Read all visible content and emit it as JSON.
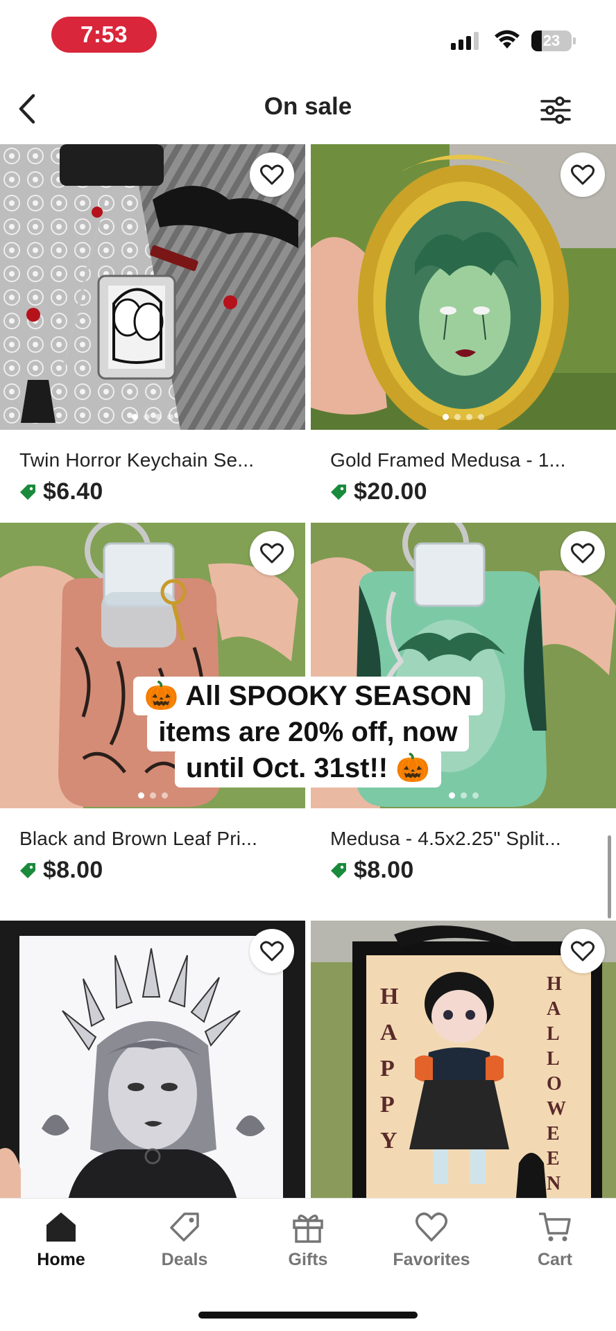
{
  "status_bar": {
    "time": "7:53",
    "battery": "23"
  },
  "header": {
    "title": "On sale"
  },
  "products": [
    {
      "title": "Twin Horror Keychain Se...",
      "price": "$6.40"
    },
    {
      "title": "Gold Framed Medusa - 1...",
      "price": "$20.00"
    },
    {
      "title": "Black and Brown Leaf Pri...",
      "price": "$8.00"
    },
    {
      "title": "Medusa - 4.5x2.25\" Split...",
      "price": "$8.00"
    }
  ],
  "overlay": {
    "lines": [
      "🎃 All SPOOKY SEASON",
      "items are 20% off, now",
      "until Oct. 31st!! 🎃"
    ]
  },
  "card6_art": {
    "left": "HAPPY",
    "right": "HALLOWEEN"
  },
  "nav": [
    {
      "label": "Home",
      "icon": "home-icon",
      "active": true
    },
    {
      "label": "Deals",
      "icon": "tag-icon",
      "active": false
    },
    {
      "label": "Gifts",
      "icon": "gift-icon",
      "active": false
    },
    {
      "label": "Favorites",
      "icon": "heart-icon",
      "active": false
    },
    {
      "label": "Cart",
      "icon": "cart-icon",
      "active": false
    }
  ],
  "colors": {
    "sale_green": "#1a8a3c",
    "time_pill": "#d9263a",
    "text": "#222222"
  }
}
